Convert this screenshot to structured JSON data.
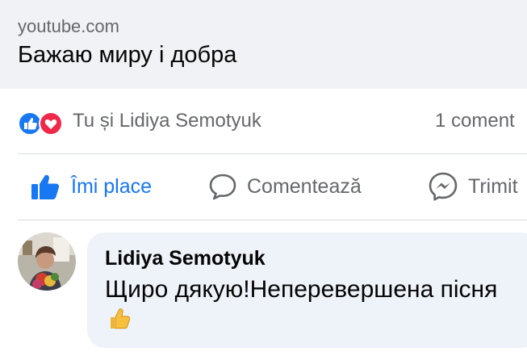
{
  "link_preview": {
    "domain": "youtube.com",
    "title": "Бажаю миру і добра"
  },
  "reactions": {
    "icons": [
      "like-icon",
      "love-icon"
    ],
    "names": "Tu și Lidiya Semotyuk",
    "comment_count": "1 coment"
  },
  "actions": {
    "like_label": "Îmi place",
    "comment_label": "Comentează",
    "share_label": "Trimit"
  },
  "comment": {
    "author": "Lidiya Semotyuk",
    "text": "Щиро дякую!Неперевершена пісня",
    "emoji": "thumbs-up-emoji"
  },
  "colors": {
    "accent": "#1877f2",
    "love": "#f0284a",
    "secondary_text": "#65676b",
    "bubble": "#eef3f9",
    "preview_bg": "#f0f2f5"
  }
}
